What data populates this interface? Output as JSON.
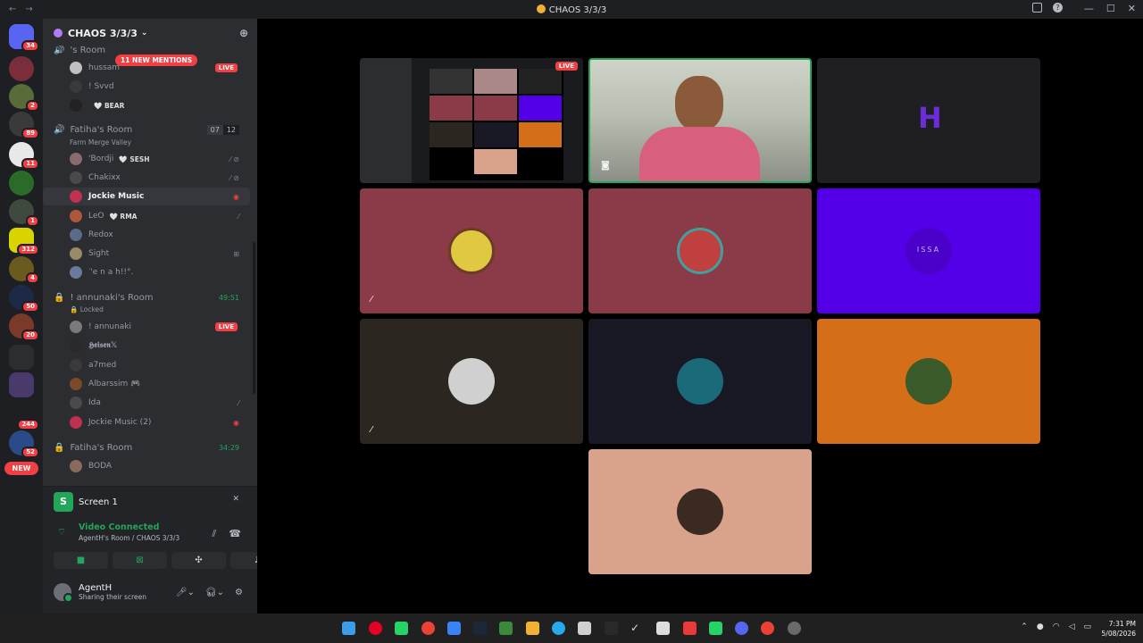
{
  "titlebar": {
    "title": "CHAOS 3/3/3",
    "back": "←",
    "forward": "→",
    "inbox_icon": "inbox-icon",
    "help": "?",
    "minimize": "—",
    "maximize": "☐",
    "close": "✕"
  },
  "guild": {
    "name": "CHAOS 3/3/3",
    "chevron": "⌄",
    "add_member_icon": "add-member-icon",
    "mentions_pill": "11 NEW MENTIONS"
  },
  "server_badges": [
    "34",
    "2",
    "89",
    "11",
    "1",
    "312",
    "4",
    "50",
    "20",
    "244",
    "52"
  ],
  "server_new": "NEW",
  "channels": {
    "room1_partial": "'s Room",
    "room1_members": [
      {
        "name": "hussam",
        "live": "LIVE"
      },
      {
        "name": "! Svvd"
      },
      {
        "name": "",
        "tag": "🤍 BEAR"
      }
    ],
    "room2": {
      "name": "Fatiha's Room",
      "sub": "Farm Merge Valley",
      "count_a": "07",
      "count_b": "12",
      "members": [
        {
          "name": "'Bordji",
          "tag": "🤍 SESH"
        },
        {
          "name": "Chakixx"
        },
        {
          "name": "Jockie Music"
        },
        {
          "name": "LeO",
          "tag": "🤍 RMA"
        },
        {
          "name": "Redox"
        },
        {
          "name": "Sight"
        },
        {
          "name": "ᐝ'e n a h!!°."
        }
      ]
    },
    "room3": {
      "name": "! annunaki's Room",
      "time": "49:51",
      "sub": "🔒 Locked",
      "members": [
        {
          "name": "! annunaki",
          "live": "LIVE"
        },
        {
          "name": "𝕳𝖊𝖎𝖘𝖊𝖓𝕏"
        },
        {
          "name": "a7med"
        },
        {
          "name": "Albarssim 🎮"
        },
        {
          "name": "Ida"
        },
        {
          "name": "Jockie Music (2)"
        }
      ]
    },
    "room4": {
      "name": "Fatiha's Room",
      "time": "34:29",
      "members": [
        {
          "name": "BODA"
        }
      ]
    }
  },
  "panel": {
    "screen_label": "Screen 1",
    "screen_icon_letter": "S",
    "voice_status": "Video Connected",
    "voice_location": "AgentH's Room / CHAOS 3/3/3",
    "buttons": [
      "camera-icon",
      "share-screen-icon",
      "activities-icon",
      "soundboard-icon"
    ],
    "user_name": "AgentH",
    "user_status": "Sharing their screen"
  },
  "stage": {
    "tile1_live": "LIVE",
    "tile3_initial": "H",
    "tile6_text": "ISSA"
  },
  "taskbar": {
    "time": "7:31 PM",
    "date": "5/08/2026"
  },
  "colors": {
    "accent_green": "#23a55a",
    "live_red": "#f23f43",
    "tile_red": "#8b3a48",
    "tile_purple": "#5300e8",
    "tile_orange": "#d46e18",
    "tile_peach": "#d8a38a",
    "tile_brown": "#2b2620",
    "tile_dark": "#191926"
  }
}
